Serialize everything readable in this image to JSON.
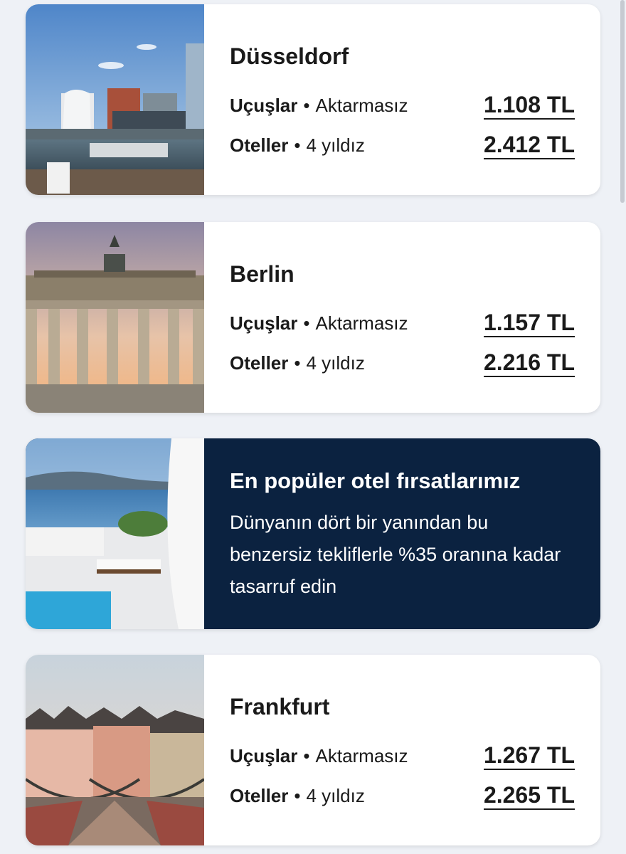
{
  "destinations": [
    {
      "city": "Düsseldorf",
      "flights_label": "Uçuşlar",
      "flights_detail": "Aktarmasız",
      "flights_price": "1.108 TL",
      "hotels_label": "Oteller",
      "hotels_detail": "4 yıldız",
      "hotels_price": "2.412 TL"
    },
    {
      "city": "Berlin",
      "flights_label": "Uçuşlar",
      "flights_detail": "Aktarmasız",
      "flights_price": "1.157 TL",
      "hotels_label": "Oteller",
      "hotels_detail": "4 yıldız",
      "hotels_price": "2.216 TL"
    },
    {
      "city": "Frankfurt",
      "flights_label": "Uçuşlar",
      "flights_detail": "Aktarmasız",
      "flights_price": "1.267 TL",
      "hotels_label": "Oteller",
      "hotels_detail": "4 yıldız",
      "hotels_price": "2.265 TL"
    }
  ],
  "promo": {
    "title": "En popüler otel fırsatlarımız",
    "body": "Dünyanın dört bir yanından bu benzersiz tekliflerle %35 oranına kadar tasarruf edin"
  },
  "separator": "•",
  "colors": {
    "background": "#eef1f6",
    "card": "#ffffff",
    "promo_card": "#0b2240",
    "text": "#1a1a1a"
  }
}
